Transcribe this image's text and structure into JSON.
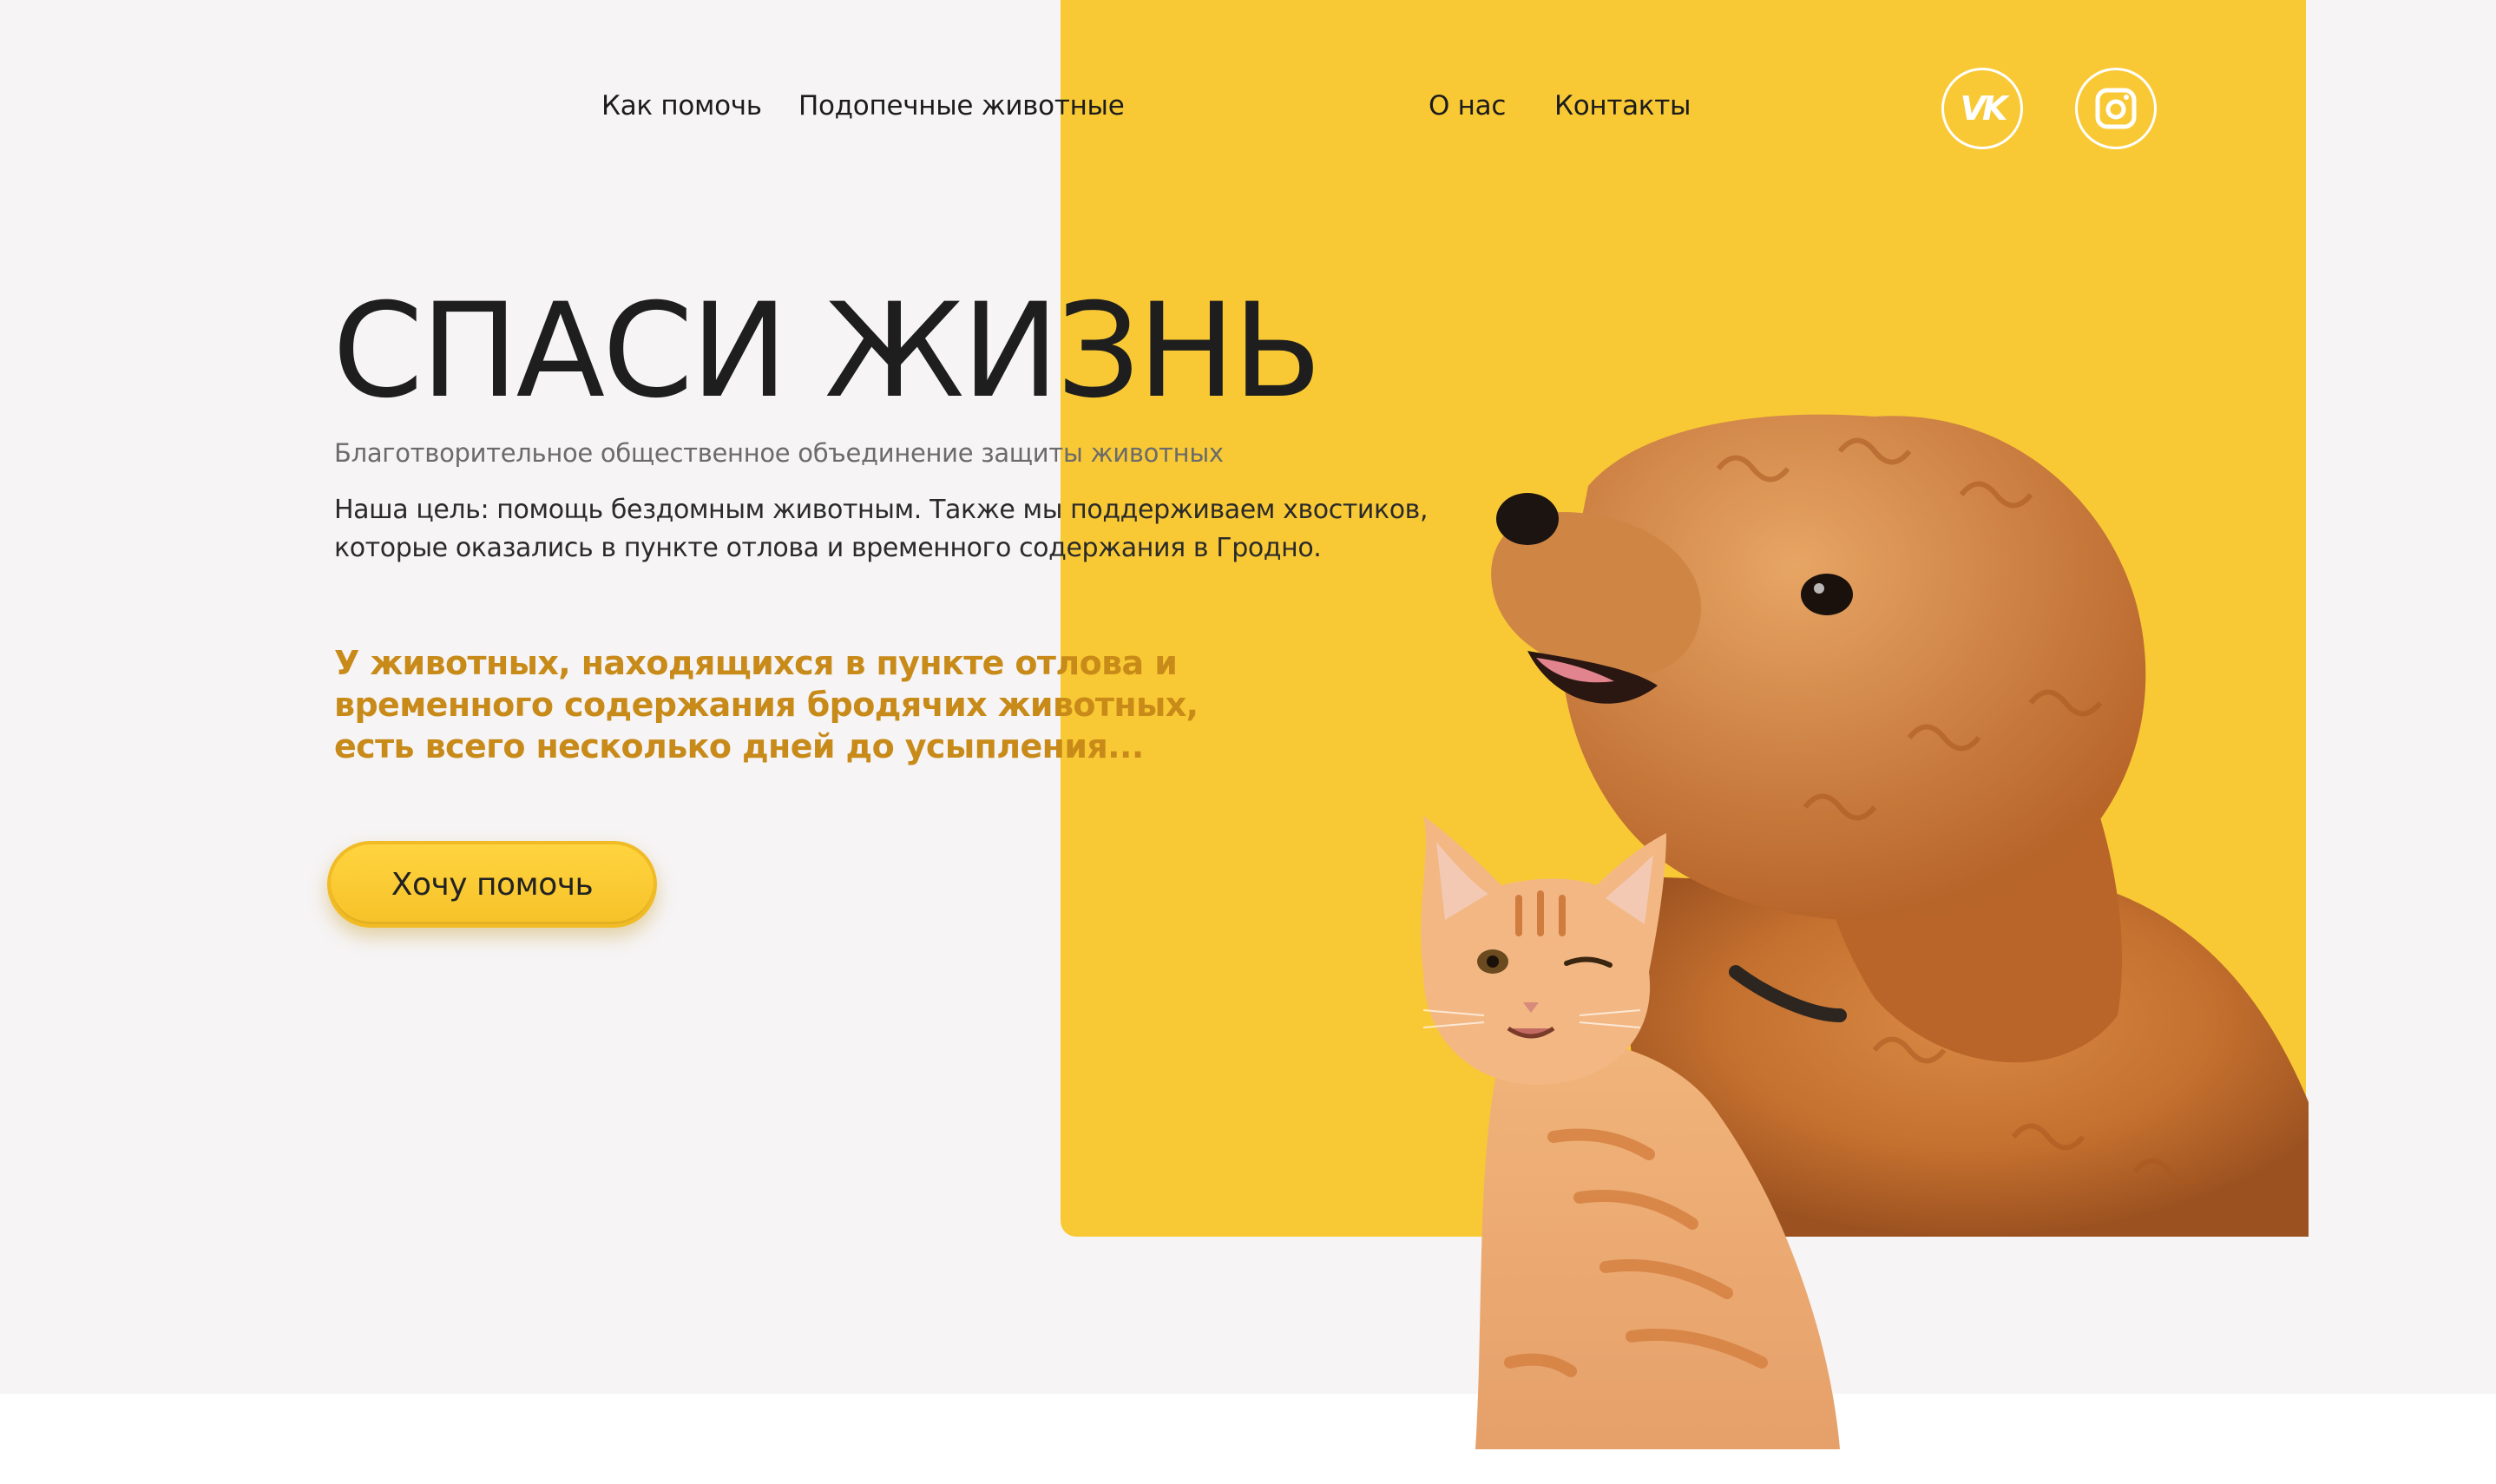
{
  "nav": {
    "items": [
      {
        "label": "Как помочь"
      },
      {
        "label": "Подопечные животные"
      },
      {
        "label": "О нас"
      },
      {
        "label": "Контакты"
      }
    ]
  },
  "social": {
    "vk": {
      "icon": "vk-icon",
      "glyph": "VK"
    },
    "instagram": {
      "icon": "instagram-icon"
    }
  },
  "hero": {
    "title": "СПАСИ ЖИЗНЬ",
    "subtitle": "Благотворительное общественное объединение защиты животных",
    "goal_lines": [
      "Наша цель: помощь бездомным животным. Также мы поддерживаем хвостиков,",
      "которые оказались в пункте отлова и временного содержания в Гродно."
    ],
    "warning_lines": [
      "У животных, находящихся в пункте отлова и",
      "временного содержания бродячих животных,",
      "есть всего несколько дней до усыпления..."
    ],
    "cta_label": "Хочу помочь"
  },
  "images": {
    "dog": "dog-photo",
    "cat": "cat-photo"
  },
  "colors": {
    "accent_yellow": "#f9c935",
    "warning_text": "#c88a18",
    "hero_background": "#f6f4f5",
    "dark_text": "#1e1e1e"
  }
}
